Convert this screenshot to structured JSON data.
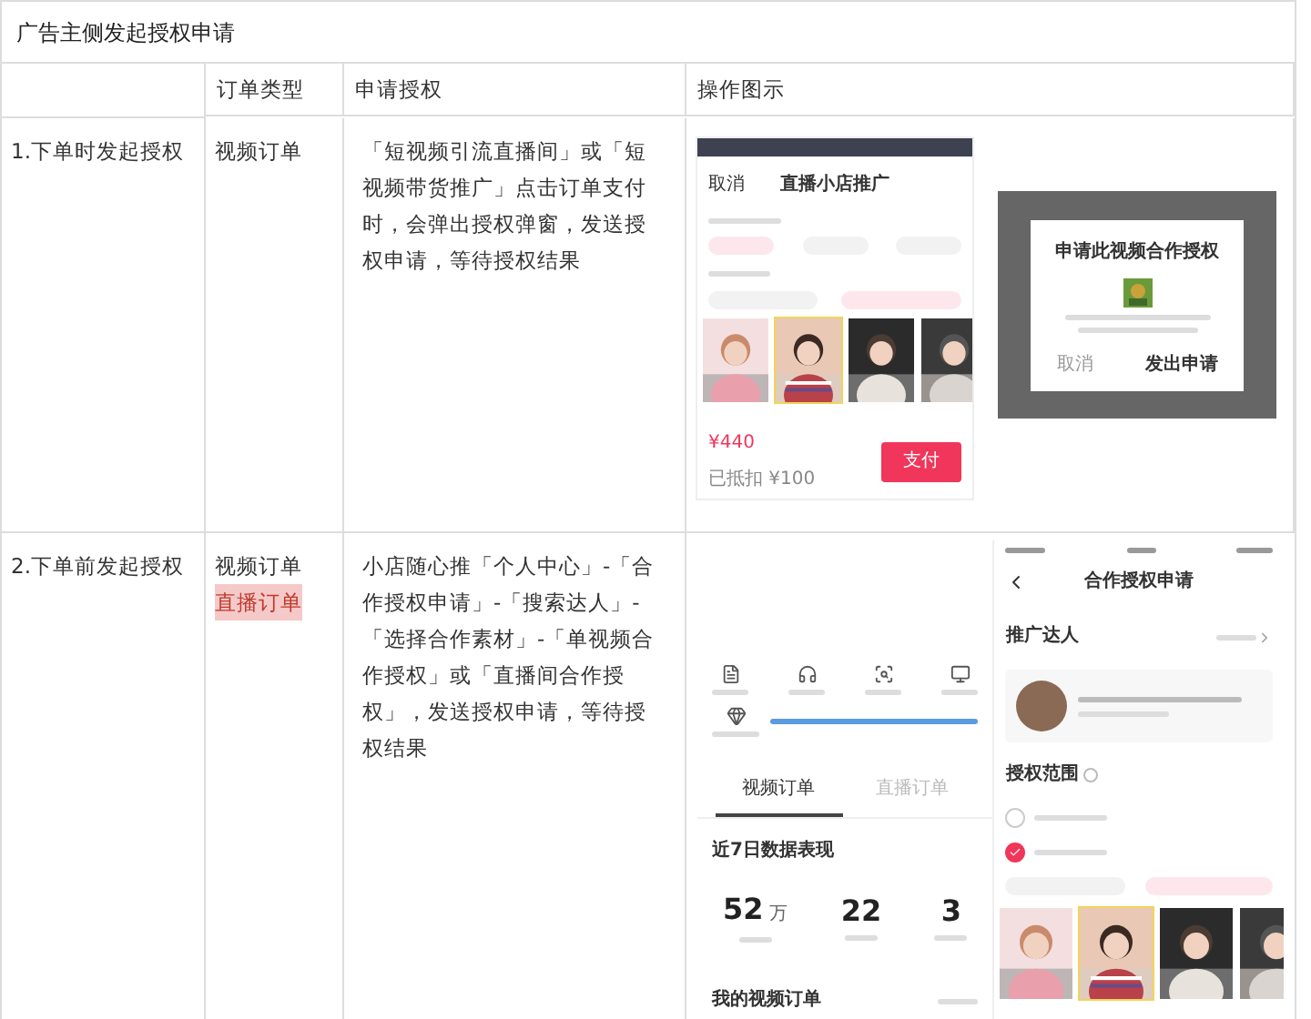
{
  "title": "广告主侧发起授权申请",
  "table": {
    "columns": [
      {
        "label": "订单类型"
      },
      {
        "label": "申请授权"
      },
      {
        "label": "操作图示"
      }
    ],
    "rows": [
      {
        "step": "1.下单时发起授权",
        "order_types": [
          {
            "label": "视频订单",
            "highlighted": false
          }
        ],
        "description": "「短视频引流直播间」或「短视频带货推广」点击订单支付时，会弹出授权弹窗，发送授权申请，等待授权结果",
        "screens": [
          {
            "kind": "promo_order",
            "cancel": "取消",
            "title": "直播小店推广",
            "thumbs": [
              {
                "selected": false
              },
              {
                "selected": true
              },
              {
                "selected": false
              },
              {
                "selected": false
              }
            ],
            "price": "¥440",
            "discount": "已抵扣 ¥100",
            "button": "支付"
          },
          {
            "kind": "auth_dialog",
            "title": "申请此视频合作授权",
            "cancel": "取消",
            "confirm": "发出申请"
          }
        ]
      },
      {
        "step": "2.下单前发起授权",
        "order_types": [
          {
            "label": "视频订单",
            "highlighted": false
          },
          {
            "label": "直播订单",
            "highlighted": true
          }
        ],
        "description": "小店随心推「个人中心」-「合作授权申请」-「搜索达人」-「选择合作素材」-「单视频合作授权」或「直播间合作授权」，发送授权申请，等待授权结果",
        "screens": [
          {
            "kind": "account_center",
            "tabs": [
              {
                "label": "视频订单",
                "selected": true
              },
              {
                "label": "直播订单",
                "selected": false
              }
            ],
            "stats_title": "近7日数据表现",
            "stats": [
              {
                "value": "52",
                "unit": "万"
              },
              {
                "value": "22"
              },
              {
                "value": "3"
              }
            ],
            "orders_title": "我的视频订单"
          },
          {
            "kind": "auth_request",
            "title": "合作授权申请",
            "section": "推广达人",
            "scope": "授权范围",
            "options": [
              {
                "checked": false
              },
              {
                "checked": true
              }
            ],
            "thumbs": [
              {
                "selected": false
              },
              {
                "selected": true
              },
              {
                "selected": false
              },
              {
                "selected": false
              }
            ]
          }
        ]
      }
    ]
  }
}
